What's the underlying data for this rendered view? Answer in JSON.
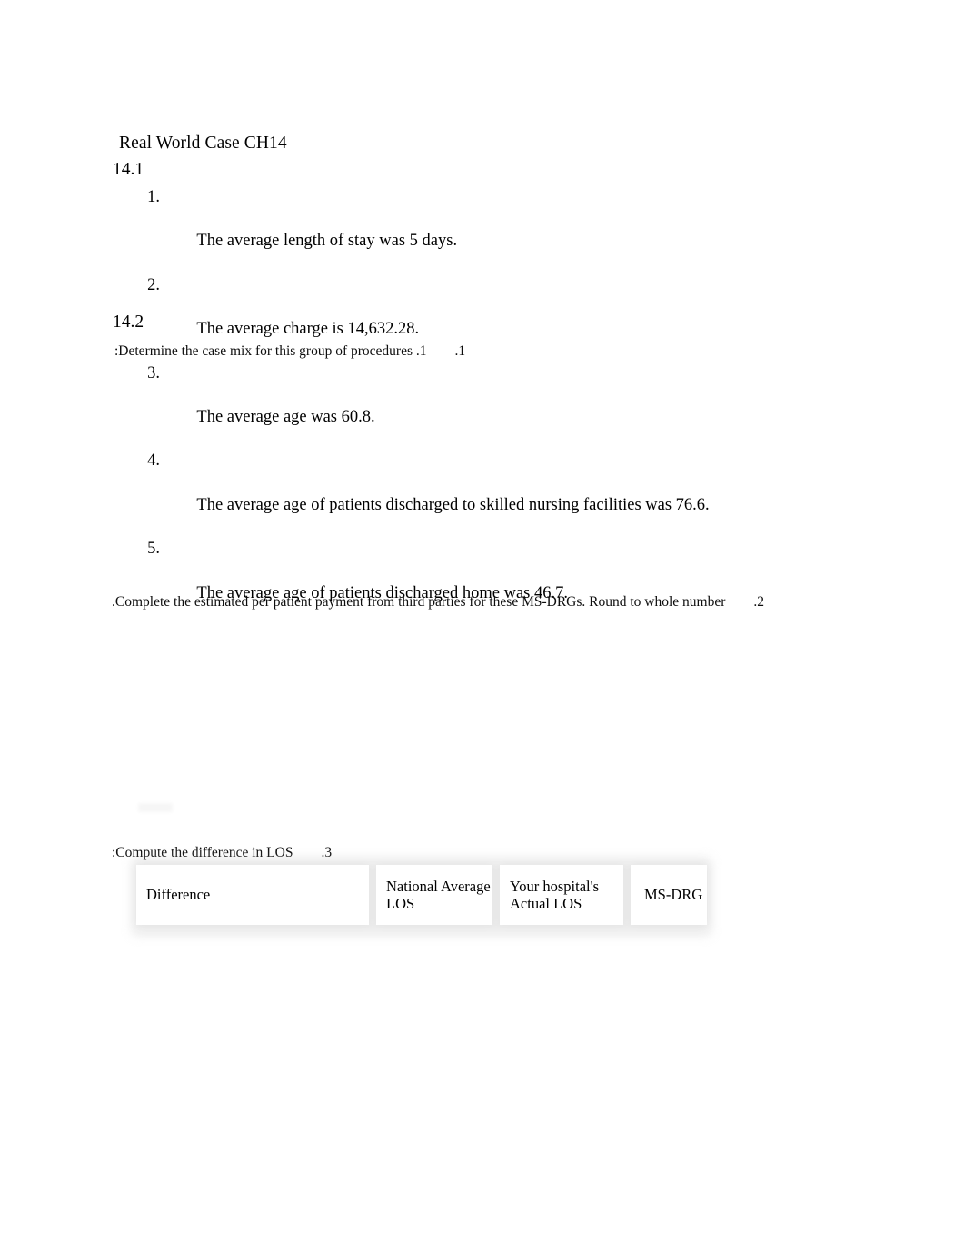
{
  "document": {
    "title": "Real World Case CH14",
    "background_color": "#ffffff",
    "text_color": "#000000"
  },
  "sections": {
    "section_1": {
      "heading": "14.1",
      "list": [
        {
          "number": "1.",
          "text": "The average length of stay was 5 days."
        },
        {
          "number": "2.",
          "text": "The average charge is 14,632.28."
        },
        {
          "number": "3.",
          "text": "The average age was 60.8."
        },
        {
          "number": "4.",
          "text": "The average age of patients discharged to skilled nursing facilities was 76.6."
        },
        {
          "number": "5.",
          "text": "The average age of patients discharged home was 46.7."
        }
      ]
    },
    "section_2": {
      "heading": "14.2",
      "instructions": [
        ":Determine the case mix for this group of procedures .1        .1",
        ".Complete the estimated per patient payment from third parties for these MS-DRGs. Round to whole number        .2",
        ":Compute the difference in LOS        .3"
      ]
    }
  },
  "los_table": {
    "headers": [
      "Difference",
      "National Average\nLOS",
      "Your hospital's\nActual LOS",
      "MS-DRG"
    ],
    "rows": []
  }
}
